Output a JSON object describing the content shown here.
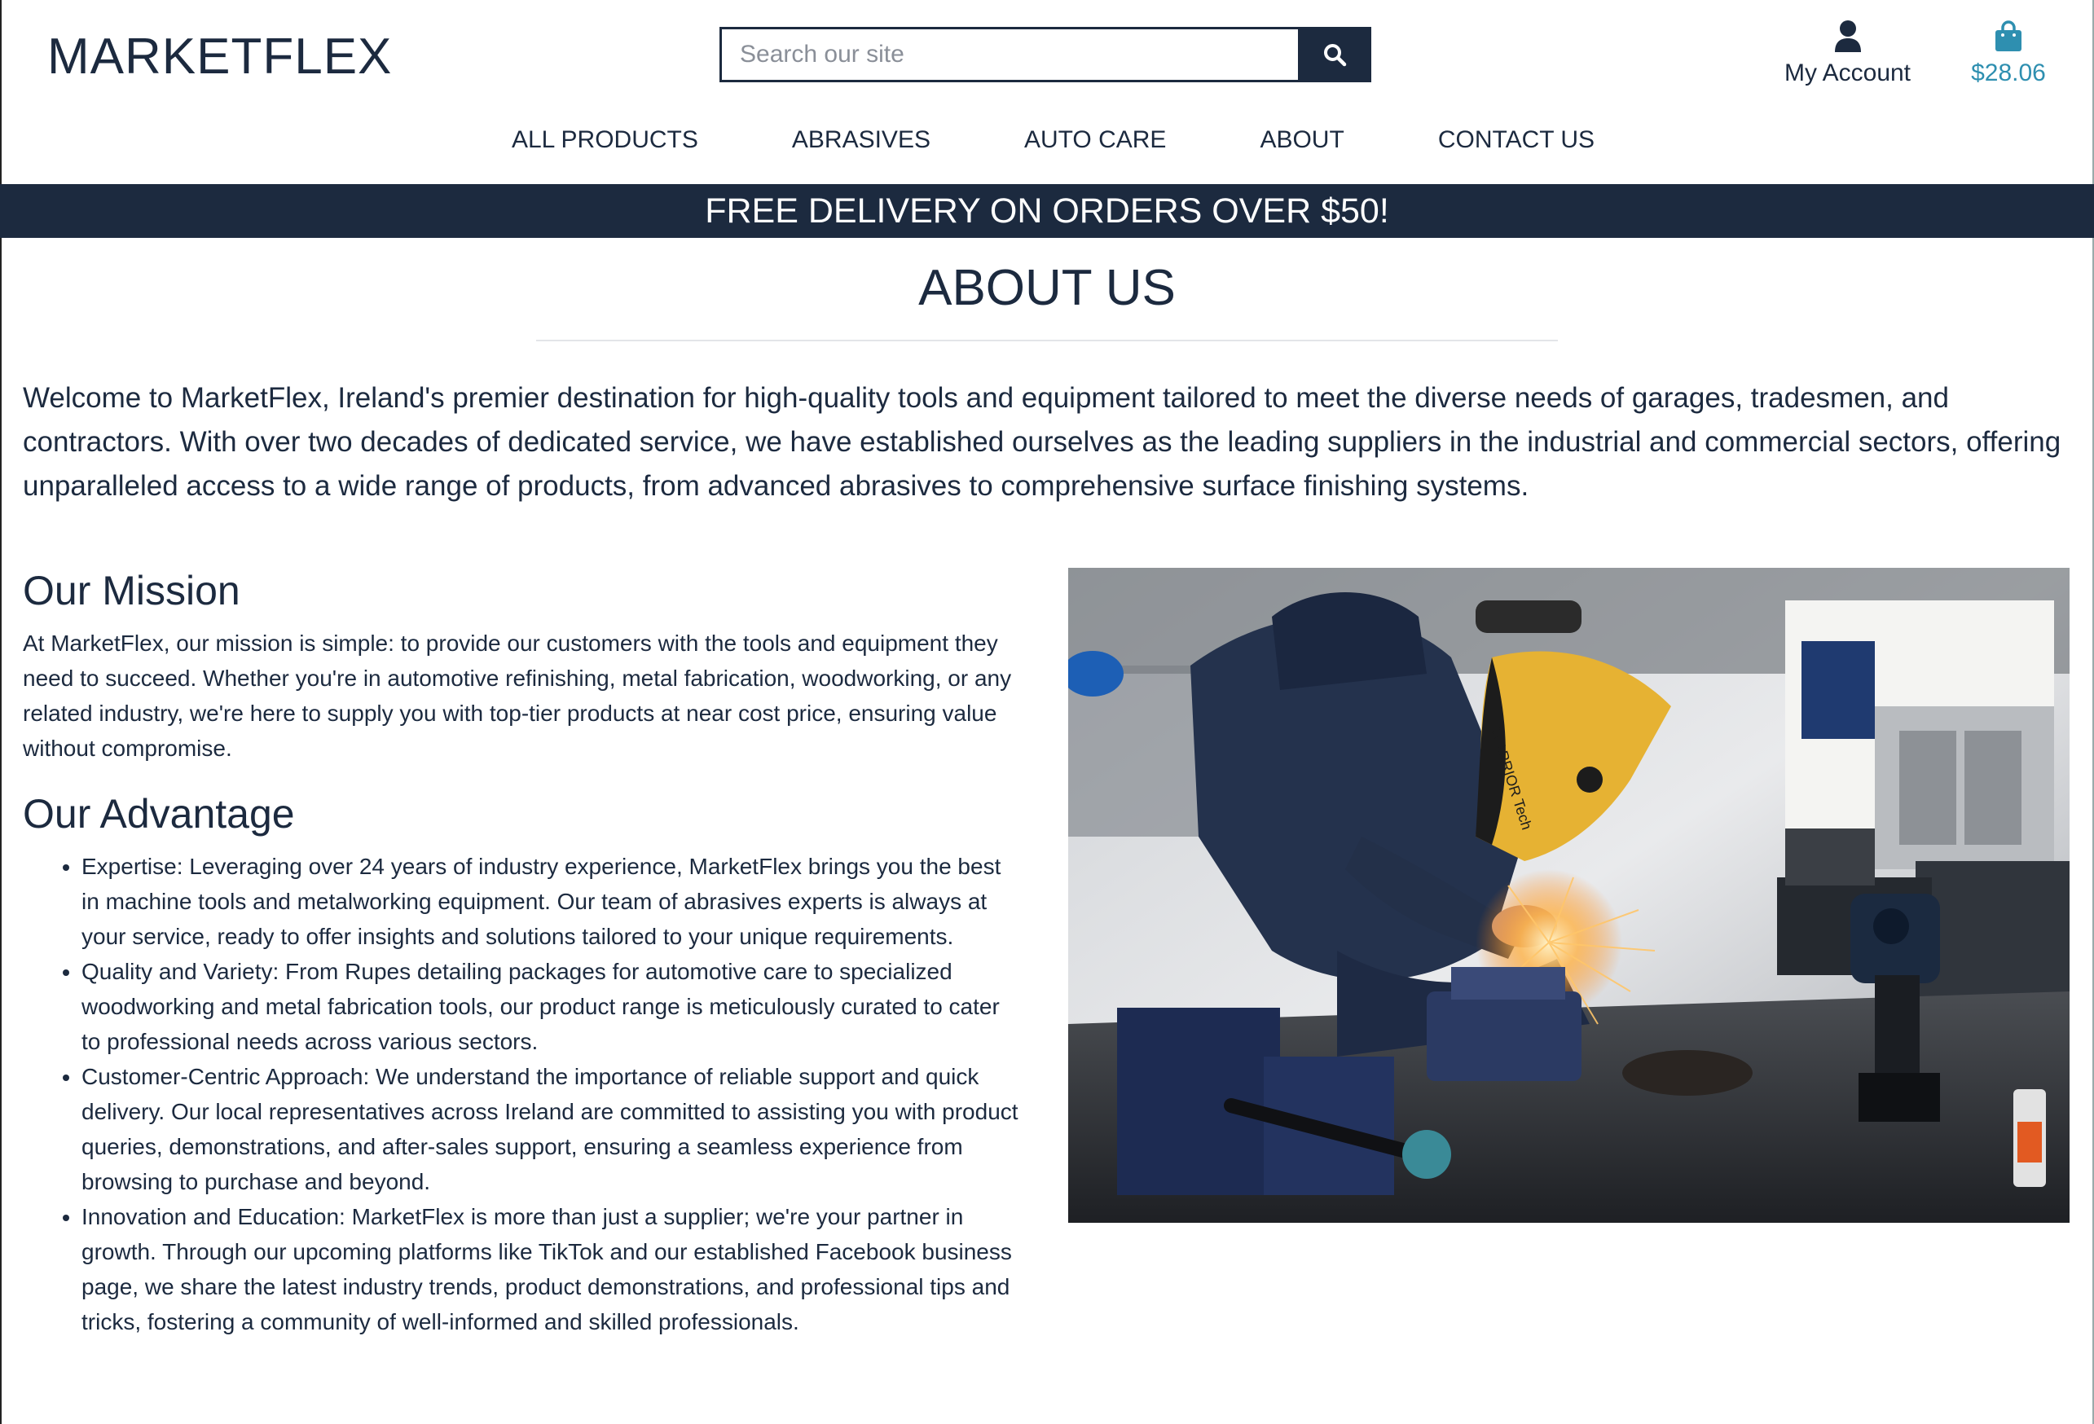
{
  "header": {
    "logo": "MARKETFLEX",
    "search_placeholder": "Search our site",
    "account_label": "My Account",
    "bag_total": "$28.06"
  },
  "nav": [
    "ALL PRODUCTS",
    "ABRASIVES",
    "AUTO CARE",
    "ABOUT",
    "CONTACT US"
  ],
  "banner": "FREE DELIVERY ON ORDERS OVER $50!",
  "main": {
    "title": "ABOUT US",
    "intro": "Welcome to MarketFlex, Ireland's premier destination for high-quality tools and equipment tailored to meet the diverse needs of garages, tradesmen, and contractors. With over two decades of dedicated service, we have established ourselves as the leading suppliers in the industrial and commercial sectors, offering unparalleled access to a wide range of products, from advanced abrasives to comprehensive surface finishing systems.",
    "mission_title": "Our Mission",
    "mission_text": "At MarketFlex, our mission is simple: to provide our customers with the tools and equipment they need to succeed. Whether you're in automotive refinishing, metal fabrication, woodworking, or any related industry, we're here to supply you with top-tier products at near cost price, ensuring value without compromise.",
    "advantage_title": "Our Advantage",
    "advantages": [
      "Expertise: Leveraging over 24 years of industry experience, MarketFlex brings you the best in machine tools and metalworking equipment. Our team of abrasives experts is always at your service, ready to offer insights and solutions tailored to your unique requirements.",
      "Quality and Variety: From Rupes detailing packages for automotive care to specialized woodworking and metal fabrication tools, our product range is meticulously curated to cater to professional needs across various sectors.",
      "Customer-Centric Approach: We understand the importance of reliable support and quick delivery. Our local representatives across Ireland are committed to assisting you with product queries, demonstrations, and after-sales support, ensuring a seamless experience from browsing to purchase and beyond.",
      "Innovation and Education: MarketFlex is more than just a supplier; we're your partner in growth. Through our upcoming platforms like TikTok and our established Facebook business page, we share the latest industry trends, product demonstrations, and professional tips and tricks, fostering a community of well-informed and skilled professionals."
    ],
    "photo_text": "WARRIOR Tech"
  },
  "colors": {
    "primary": "#1c2a3f",
    "accent": "#2e8fb0",
    "banner_text": "#ffffff"
  },
  "icons": {
    "search": "search-icon",
    "account": "user-icon",
    "bag": "shopping-bag-icon"
  }
}
